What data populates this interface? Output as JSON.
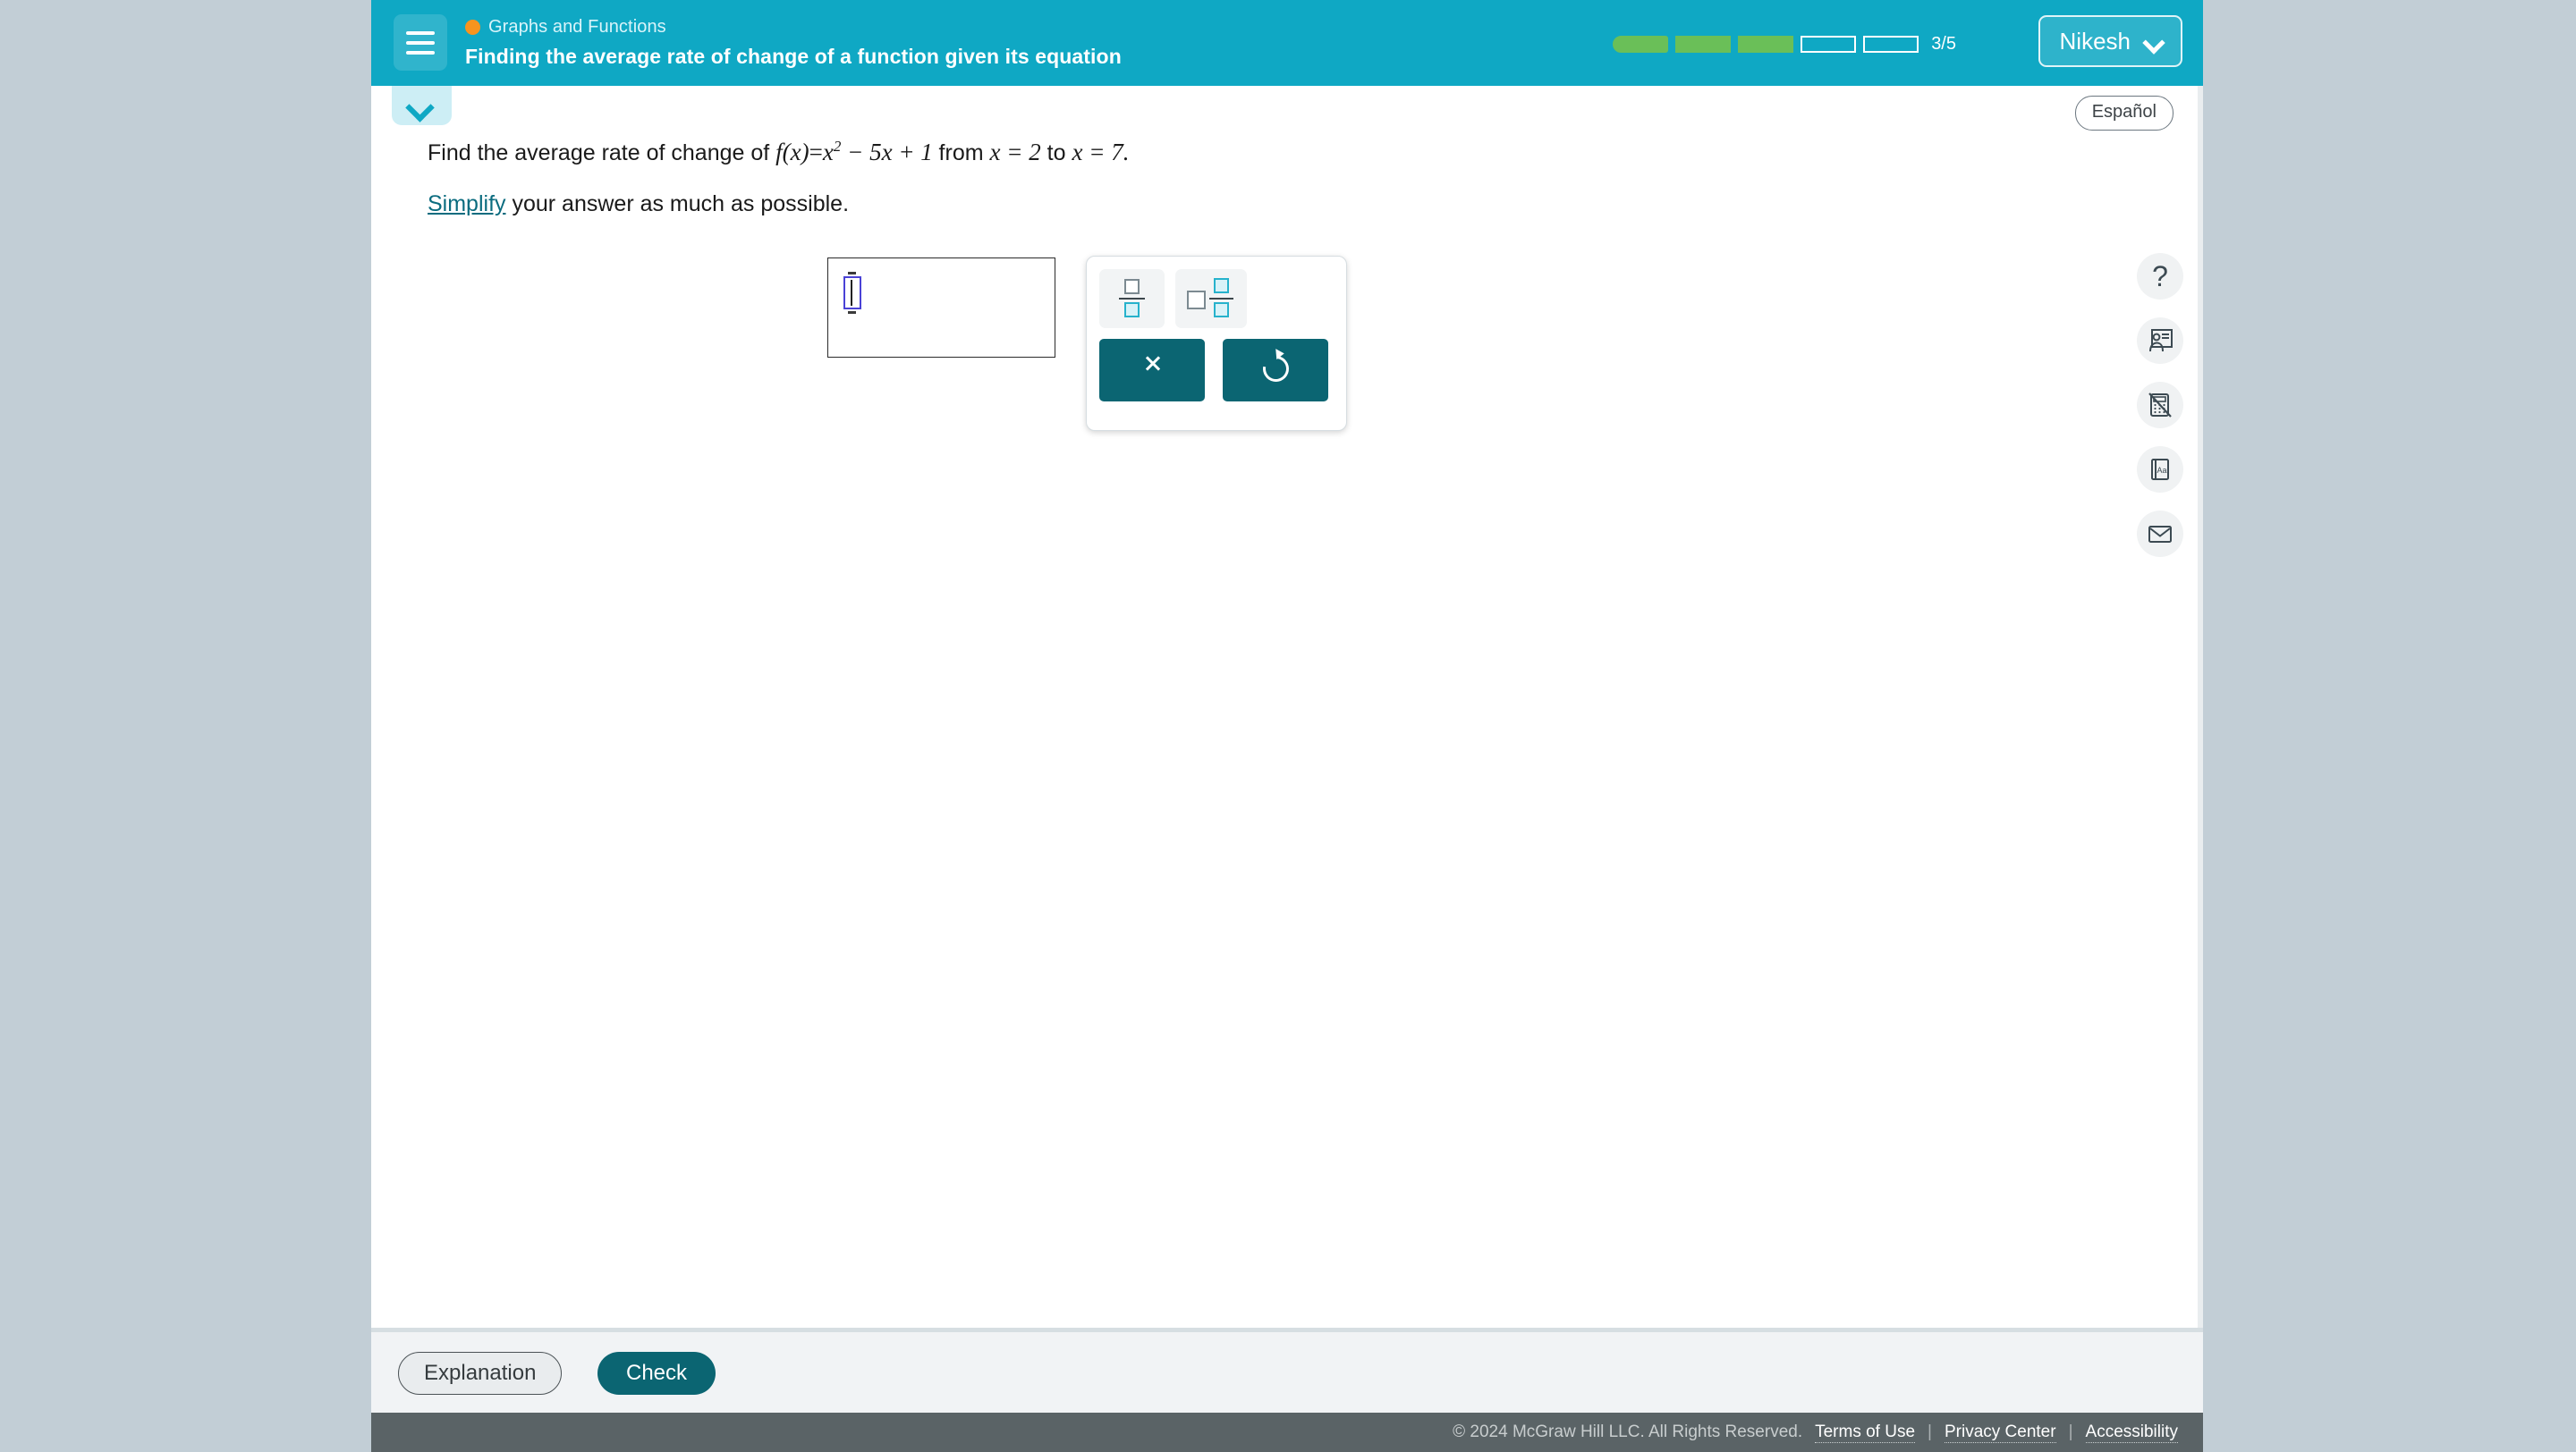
{
  "colors": {
    "header_teal": "#0fa8c4",
    "accent_dark_teal": "#0b6572",
    "progress_green": "#6abf58",
    "topic_dot_orange": "#f7941e",
    "page_backdrop": "#c2ced6",
    "footer_gray": "#5a6366",
    "placeholder_blue": "#4a42d6"
  },
  "header": {
    "menu_icon": "hamburger-menu-icon",
    "topic": "Graphs and Functions",
    "topic_dot_icon": "orange-circle-icon",
    "lesson_title": "Finding the average rate of change of a function given its equation",
    "progress": {
      "total_segments": 5,
      "completed_segments": 3,
      "count_label": "3/5"
    },
    "user": {
      "name": "Nikesh",
      "chevron_icon": "chevron-down-icon"
    }
  },
  "collapse_tab": {
    "icon": "chevron-down-icon"
  },
  "language_toggle": {
    "label": "Español"
  },
  "problem": {
    "prompt_prefix": "Find the average rate of change of",
    "function_name": "f",
    "function_arg": "(x)",
    "equals": "=",
    "term_x": "x",
    "exponent": "2",
    "rest": "− 5x + 1",
    "from_word": "from",
    "from_value": "x = 2",
    "to_word": "to",
    "to_value": "x = 7.",
    "full_equation": "f(x) = x² − 5x + 1",
    "instruction_link": "Simplify",
    "instruction_rest": "your answer as much as possible."
  },
  "answer": {
    "value": "",
    "placeholder": "",
    "cursor_visible": true
  },
  "math_toolbar": {
    "buttons": [
      {
        "name": "fraction-template-button",
        "icon": "fraction-icon",
        "label": "Fraction"
      },
      {
        "name": "mixed-number-template-button",
        "icon": "mixed-number-icon",
        "label": "Mixed number"
      },
      {
        "name": "clear-button",
        "icon": "close-x-icon",
        "label": "Clear"
      },
      {
        "name": "undo-button",
        "icon": "undo-arrow-icon",
        "label": "Undo"
      }
    ]
  },
  "tool_rail": [
    {
      "name": "help-button",
      "icon": "question-mark-icon",
      "label": "?"
    },
    {
      "name": "tutorial-video-button",
      "icon": "person-screen-icon",
      "label": ""
    },
    {
      "name": "calculator-button",
      "icon": "calculator-disabled-icon",
      "label": ""
    },
    {
      "name": "glossary-button",
      "icon": "book-aa-icon",
      "label": "Aa"
    },
    {
      "name": "message-button",
      "icon": "envelope-icon",
      "label": ""
    }
  ],
  "actions": {
    "explanation_label": "Explanation",
    "check_label": "Check"
  },
  "footer": {
    "copyright": "© 2024 McGraw Hill LLC. All Rights Reserved.",
    "links": [
      "Terms of Use",
      "Privacy Center",
      "Accessibility"
    ],
    "separator": "|"
  }
}
